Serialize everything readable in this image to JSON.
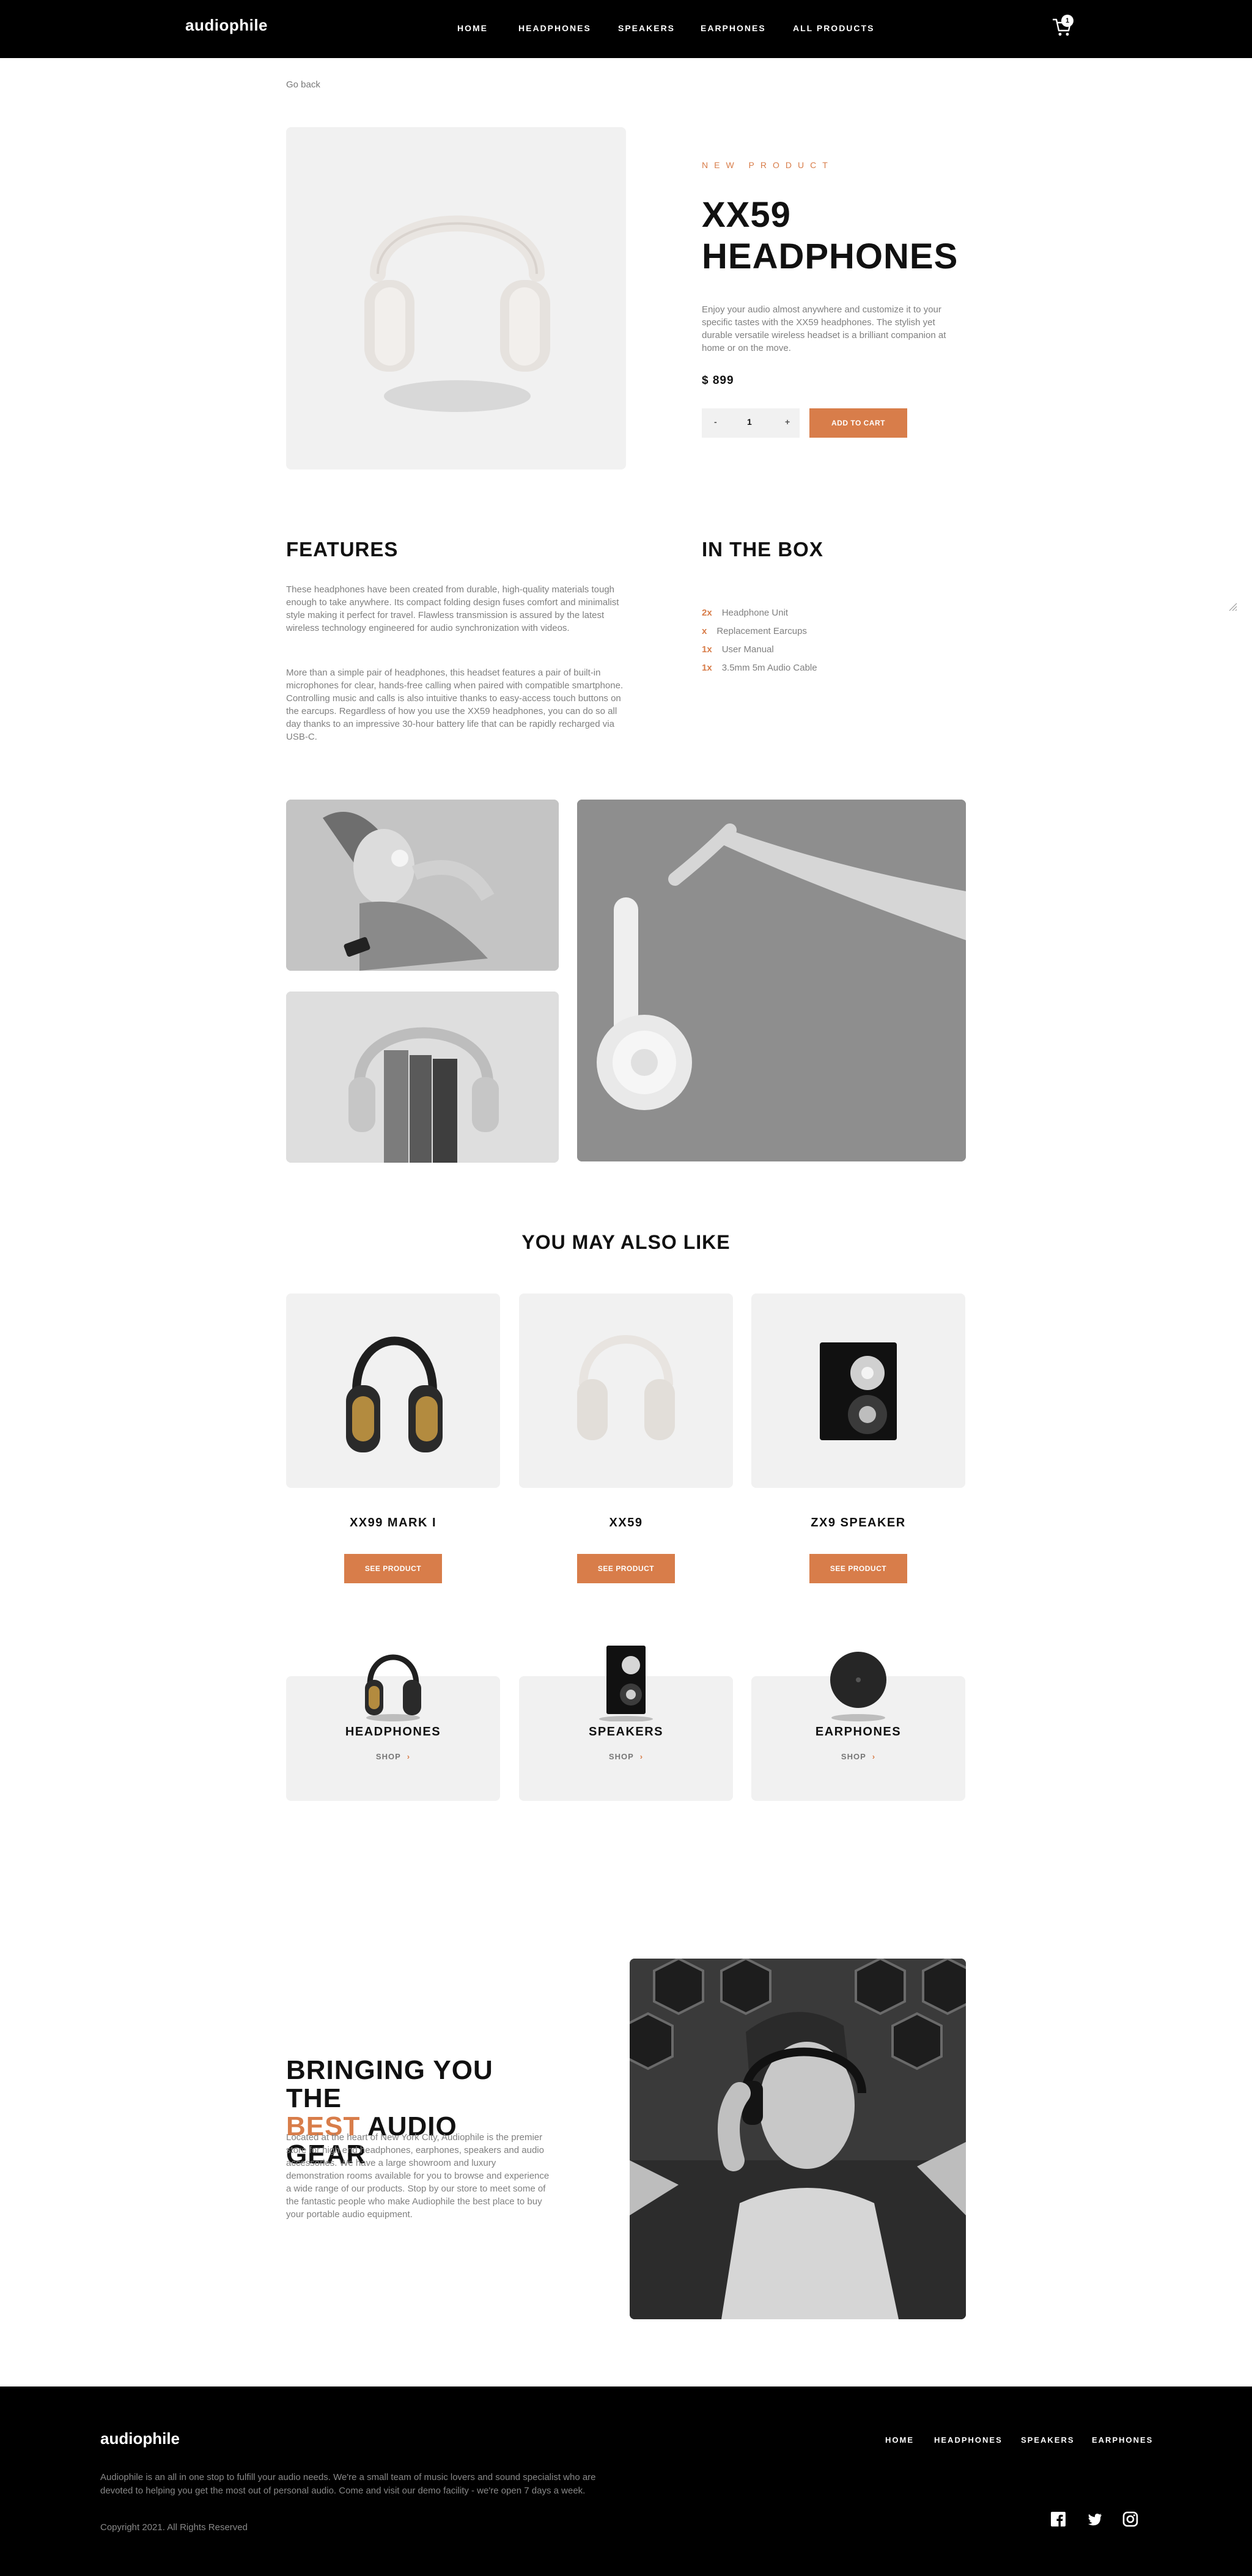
{
  "header": {
    "logo": "audiophile",
    "nav": [
      "HOME",
      "HEADPHONES",
      "SPEAKERS",
      "EARPHONES",
      "ALL PRODUCTS"
    ],
    "cart_count": "1"
  },
  "go_back": "Go back",
  "product": {
    "eyebrow": "NEW PRODUCT",
    "title": "XX59 HEADPHONES",
    "description": "Enjoy your audio almost anywhere and customize it to your specific tastes with the XX59 headphones. The stylish yet durable versatile wireless headset is a brilliant companion at home or on the move.",
    "price": "$ 899",
    "quantity": "1",
    "qty_minus": "-",
    "qty_plus": "+",
    "add_to_cart": "ADD TO CART"
  },
  "features": {
    "heading": "FEATURES",
    "p1": "These headphones have been created from durable, high-quality materials tough enough to take anywhere. Its compact folding design fuses comfort and minimalist style making it perfect for travel. Flawless transmission is assured by the latest wireless technology engineered for audio synchronization with videos.",
    "p2": "More than a simple pair of headphones, this headset features a pair of built-in microphones for clear, hands-free calling when paired with compatible smartphone. Controlling music and calls is also intuitive thanks to easy-access touch buttons on the earcups. Regardless of how you use the XX59 headphones, you can do so all day thanks to an impressive 30-hour battery life that can be rapidly recharged via USB-C."
  },
  "in_the_box": {
    "heading": "IN THE BOX",
    "items": [
      {
        "qty": "2x",
        "item": "Headphone Unit"
      },
      {
        "qty": "x",
        "item": "Replacement Earcups"
      },
      {
        "qty": "1x",
        "item": "User Manual"
      },
      {
        "qty": "1x",
        "item": "3.5mm 5m Audio Cable"
      }
    ]
  },
  "also_like": {
    "heading": "YOU MAY ALSO LIKE",
    "items": [
      {
        "name": "XX99 MARK I",
        "button": "SEE PRODUCT"
      },
      {
        "name": "XX59",
        "button": "SEE PRODUCT"
      },
      {
        "name": "ZX9 SPEAKER",
        "button": "SEE PRODUCT"
      }
    ]
  },
  "categories": [
    {
      "name": "HEADPHONES",
      "shop": "SHOP"
    },
    {
      "name": "SPEAKERS",
      "shop": "SHOP"
    },
    {
      "name": "EARPHONES",
      "shop": "SHOP"
    }
  ],
  "about": {
    "heading_pre": "BRINGING YOU THE",
    "heading_accent": "BEST",
    "heading_post": "AUDIO GEAR",
    "body": "Located at the heart of New York City, Audiophile is the premier store for high end headphones, earphones, speakers and audio accessories. We have a large showroom and luxury demonstration rooms available for you to browse and experience a wide range of our products. Stop by our store to meet some of the fantastic people who make Audiophile the best place to buy your portable audio equipment."
  },
  "footer": {
    "logo": "audiophile",
    "nav": [
      "HOME",
      "HEADPHONES",
      "SPEAKERS",
      "EARPHONES"
    ],
    "description": "Audiophile is an all in one stop to fulfill your audio needs. We're a small team of music lovers and sound specialist who are devoted to helping you get the most out of personal audio. Come and visit our demo facility - we're open 7 days a week.",
    "copyright": "Copyright 2021. All Rights Reserved"
  },
  "colors": {
    "accent": "#d87d4a",
    "bg_light": "#f1f1f1",
    "dark": "#000000"
  }
}
